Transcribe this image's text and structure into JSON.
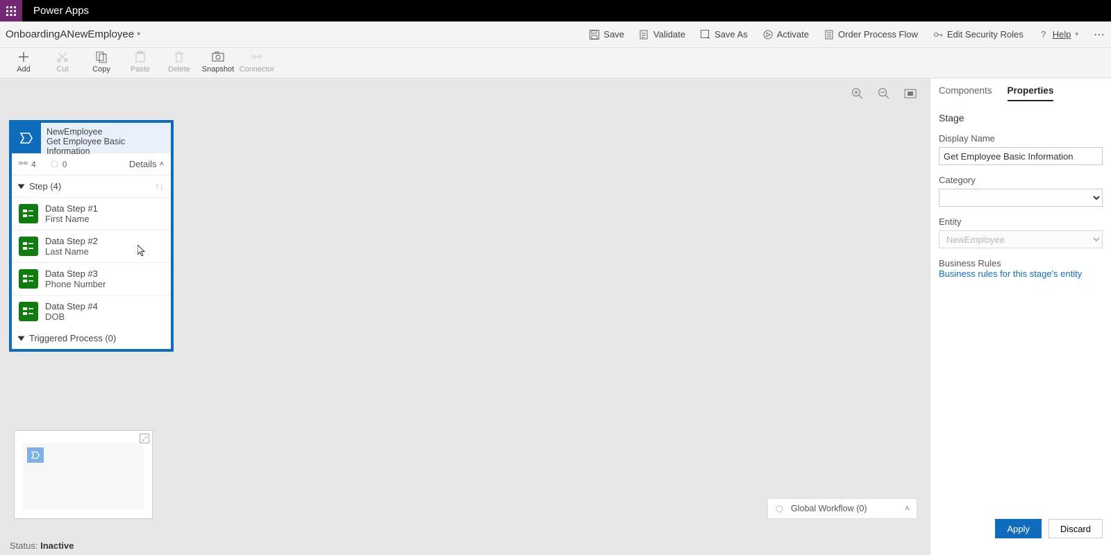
{
  "app": {
    "brand": "Power Apps"
  },
  "process": {
    "name": "OnboardingANewEmployee"
  },
  "topActions": {
    "save": "Save",
    "validate": "Validate",
    "saveAs": "Save As",
    "activate": "Activate",
    "orderFlow": "Order Process Flow",
    "editSecurity": "Edit Security Roles",
    "help": "Help"
  },
  "ribbon": {
    "add": "Add",
    "cut": "Cut",
    "copy": "Copy",
    "paste": "Paste",
    "delete": "Delete",
    "snapshot": "Snapshot",
    "connector": "Connector"
  },
  "stageCard": {
    "entity": "NewEmployee",
    "title": "Get Employee Basic Information",
    "stepCount": "4",
    "loopCount": "0",
    "detailsLabel": "Details",
    "stepHeader": "Step (4)",
    "triggeredHeader": "Triggered Process (0)",
    "steps": [
      {
        "label": "Data Step #1",
        "field": "First Name"
      },
      {
        "label": "Data Step #2",
        "field": "Last Name"
      },
      {
        "label": "Data Step #3",
        "field": "Phone Number"
      },
      {
        "label": "Data Step #4",
        "field": "DOB"
      }
    ]
  },
  "workflowTray": {
    "label": "Global Workflow (0)"
  },
  "status": {
    "label": "Status:",
    "value": "Inactive"
  },
  "rightPane": {
    "tabs": {
      "components": "Components",
      "properties": "Properties"
    },
    "section": "Stage",
    "displayNameLabel": "Display Name",
    "displayNameValue": "Get Employee Basic Information",
    "categoryLabel": "Category",
    "entityLabel": "Entity",
    "entityValue": "NewEmployee",
    "bizRulesLabel": "Business Rules",
    "bizRulesLink": "Business rules for this stage's entity",
    "apply": "Apply",
    "discard": "Discard"
  }
}
